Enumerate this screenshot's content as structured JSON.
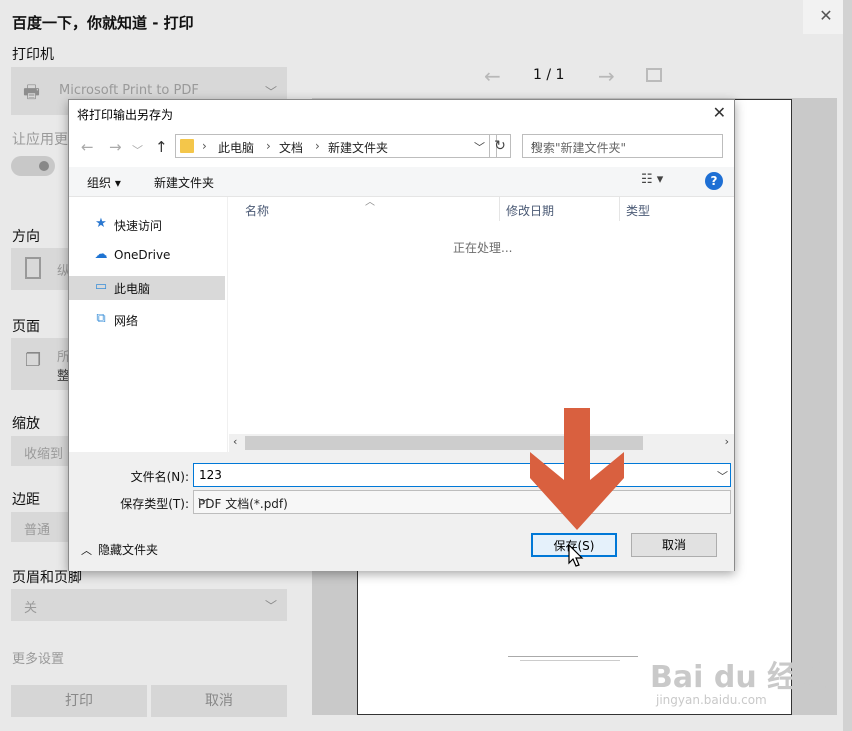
{
  "print_panel": {
    "title": "百度一下，你就知道 - 打印",
    "close_glyph": "✕",
    "printer_label": "打印机",
    "printer_value": "Microsoft Print to PDF",
    "apply_label": "让应用更",
    "orientation_label": "方向",
    "orientation_value": "纵",
    "pages_label": "页面",
    "pages_value_1": "所",
    "pages_value_2": "整",
    "scale_label": "缩放",
    "scale_value": "收缩到",
    "margins_label": "边距",
    "margins_value": "普通",
    "header_footer_label": "页眉和页脚",
    "header_footer_value": "关",
    "more_settings": "更多设置",
    "print_button": "打印",
    "cancel_button": "取消",
    "page_indicator": "1  /  1"
  },
  "save_dialog": {
    "title": "将打印输出另存为",
    "close_glyph": "✕",
    "breadcrumb": [
      "此电脑",
      "文档",
      "新建文件夹"
    ],
    "search_placeholder": "搜索\"新建文件夹\"",
    "toolbar": {
      "organize": "组织 ▾",
      "new_folder": "新建文件夹",
      "help": "?"
    },
    "nav_items": [
      {
        "label": "快速访问",
        "icon": "star-icon"
      },
      {
        "label": "OneDrive",
        "icon": "cloud-icon"
      },
      {
        "label": "此电脑",
        "icon": "computer-icon"
      },
      {
        "label": "网络",
        "icon": "network-icon"
      }
    ],
    "columns": [
      "名称",
      "修改日期",
      "类型"
    ],
    "status": "正在处理...",
    "filename_label": "文件名(N):",
    "filename_value": "123",
    "filetype_label": "保存类型(T):",
    "filetype_value": "PDF 文档(*.pdf)",
    "hide_folders": "隐藏文件夹",
    "save_button": "保存(S)",
    "cancel_button": "取消"
  },
  "watermark": {
    "logo": "Bai du 经验",
    "sub": "jingyan.baidu.com"
  },
  "colors": {
    "arrow": "#d9603f",
    "accent": "#0078d7"
  }
}
